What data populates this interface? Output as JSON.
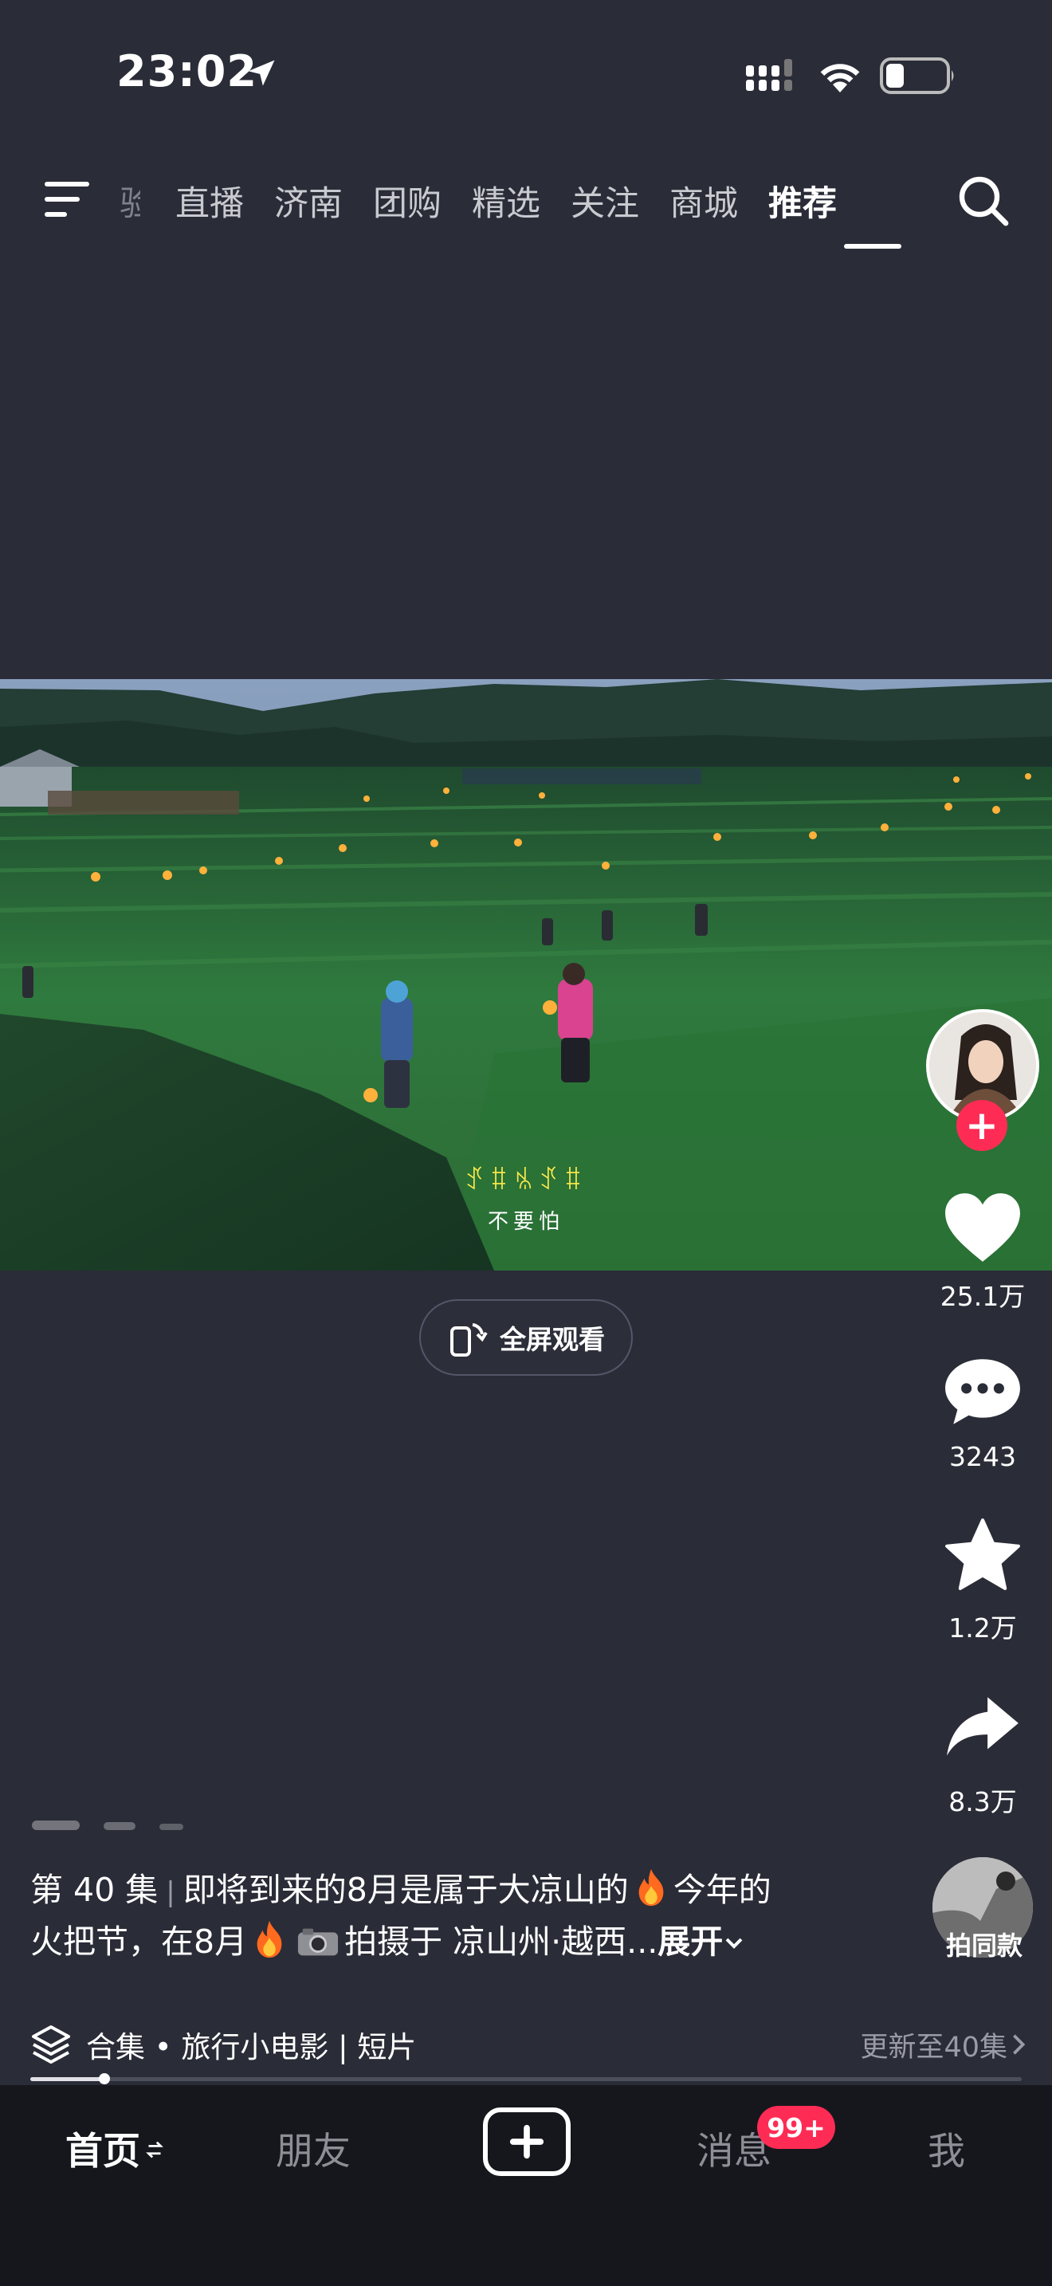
{
  "status_bar": {
    "time": "23:02"
  },
  "top_nav": {
    "tabs": [
      {
        "label": "验",
        "state": "faded"
      },
      {
        "label": "直播"
      },
      {
        "label": "济南"
      },
      {
        "label": "团购"
      },
      {
        "label": "精选"
      },
      {
        "label": "关注"
      },
      {
        "label": "商城"
      },
      {
        "label": "推荐",
        "state": "active"
      }
    ]
  },
  "video": {
    "subtitle_yi": "ꀋꐚꁱꀋꐚ",
    "subtitle_cn": "不要怕"
  },
  "fullscreen_button": {
    "label": "全屏观看"
  },
  "right_rail": {
    "follow_plus": "+",
    "likes": "25.1万",
    "comments": "3243",
    "favorites": "1.2万",
    "shares": "8.3万",
    "same_style_label": "拍同款"
  },
  "caption": {
    "episode": "第 40 集",
    "line1": "即将到来的8月是属于大凉山的",
    "line1_tail": "今年的",
    "line2_head": "火把节，在8月",
    "line2_loc": "拍摄于 凉山州·越西...",
    "expand": "展开"
  },
  "collection": {
    "title": "合集 • 旅行小电影 | 短片",
    "update": "更新至40集",
    "progress": 0.075
  },
  "bottom_nav": {
    "home": "首页",
    "friends": "朋友",
    "messages": "消息",
    "messages_badge": "99+",
    "me": "我"
  },
  "colors": {
    "background": "#2a2c37",
    "accent_red": "#fe2c55",
    "nav_background": "#16171d"
  }
}
